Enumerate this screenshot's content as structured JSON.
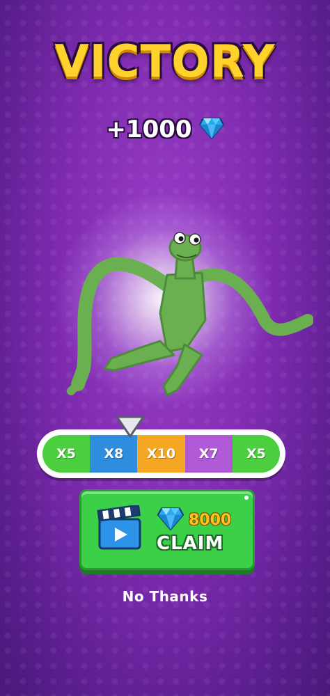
{
  "title": "VICTORY",
  "reward": {
    "amount": "+1000",
    "icon": "diamond-icon"
  },
  "multipliers": [
    {
      "label": "X5",
      "color": "#4ccf3f"
    },
    {
      "label": "X8",
      "color": "#2f8de0"
    },
    {
      "label": "X10",
      "color": "#f5a623"
    },
    {
      "label": "X7",
      "color": "#b05ad8"
    },
    {
      "label": "X5",
      "color": "#4ccf3f"
    }
  ],
  "selected_multiplier": "X8",
  "claim": {
    "amount": "8000",
    "label": "CLAIM",
    "icon": "video-ad-icon"
  },
  "no_thanks": "No Thanks",
  "colors": {
    "accent": "#ffd22e",
    "button": "#3ccf48",
    "background": "#7f2bb0"
  }
}
